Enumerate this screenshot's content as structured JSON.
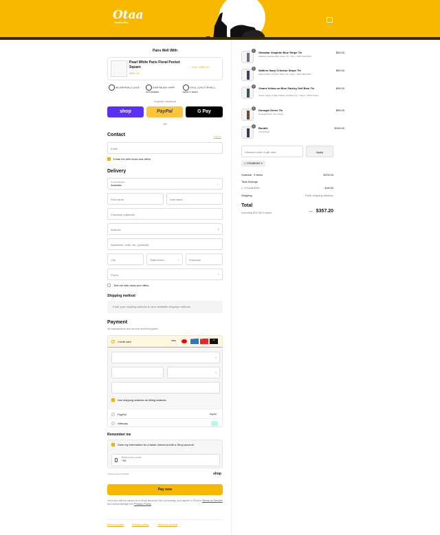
{
  "header": {
    "logo": "Otaa",
    "logo_tag": "Australia"
  },
  "pairs": {
    "title": "Pairs Well With",
    "product": "Pearl White Paris Floral Pocket Square",
    "action": "Add • A$30.00",
    "price": "A$30.00"
  },
  "badges": [
    "WE SHIP REALLY QUICK",
    "OVER 400,000+ HAPPY CUSTOMERS",
    "YOU'LL LOVE IT OR WE'LL MAKE IT RIGHT"
  ],
  "express": {
    "label": "Express checkout",
    "shop": "shop",
    "paypal": "PayPal",
    "gpay": "G Pay",
    "or": "OR"
  },
  "contact": {
    "title": "Contact",
    "login": "Log in",
    "email_placeholder": "Email",
    "news": "Email me with news and offers"
  },
  "delivery": {
    "title": "Delivery",
    "country_label": "Country/Region",
    "country": "Australia",
    "first": "First name",
    "last": "Last name",
    "company": "Company (optional)",
    "address": "Address",
    "apartment": "Apartment, suite, etc. (optional)",
    "city": "City",
    "state": "State/territo...",
    "postcode": "Postcode",
    "phone": "Phone",
    "text_news": "Text me with news and offers"
  },
  "shipping": {
    "title": "Shipping method",
    "note": "Enter your shipping address to view available shipping methods."
  },
  "payment": {
    "title": "Payment",
    "sub": "All transactions are secure and encrypted.",
    "card": "Credit card",
    "cards": [
      "VISA",
      "MC",
      "AMEX",
      "PAY",
      "+1"
    ],
    "billing": "Use shipping address as billing address",
    "paypal": "PayPal",
    "paypal_logo": "PayPal",
    "afterpay": "Afterpay"
  },
  "remember": {
    "title": "Remember me",
    "save": "Save my information for a faster checkout with a Shop account",
    "mobile_label": "Mobile phone number",
    "mobile": "+61",
    "secure": "Secure and encrypted",
    "shop": "shop"
  },
  "pay_now": "Pay now",
  "legal": {
    "text": "Your info will be saved to a Shop account. By continuing, you agree to Shop's",
    "tos": "Terms of Service",
    "and": "and acknowledge the",
    "privacy": "Privacy Policy"
  },
  "footer": [
    "Refund policy",
    "Privacy policy",
    "Terms of service"
  ],
  "items": [
    {
      "qty": "1",
      "name": "Gibraltar Graphite Blue Stripe Tie",
      "desc": "Gibraltar Graphite Blue Stripe Tie / Grey / 100% Microfiber",
      "price": "$59.00",
      "color": "#6b6f80"
    },
    {
      "qty": "1",
      "name": "Watters Navy Crimson Stripe Tie",
      "desc": "Watters Navy Crimson Stripe Tie / Navy / 100% Microfiber",
      "price": "$59.00",
      "color": "#443b66"
    },
    {
      "qty": "1",
      "name": "Vivara Yellow on Blue Paisley Self Bow Tie",
      "desc": "Vivara Yellow on Blue Paisley Self Bow Tie / Yellow / 100% Cotton",
      "price": "$49.00",
      "color": "#2e5a55"
    },
    {
      "qty": "1",
      "name": "Donegal Green Tie",
      "desc": "Donegal Green Tie / Green",
      "price": "$59.00",
      "color": "#6b4a30"
    },
    {
      "qty": "1",
      "name": "Bundle",
      "desc": "The Gift Set",
      "price": "$150.00",
      "color": "#3a3a55"
    }
  ],
  "discount": {
    "placeholder": "Discount code or gift card",
    "apply": "Apply",
    "code": "OTAABIND5"
  },
  "summary": {
    "subtotal_label": "Subtotal · 5 items",
    "subtotal": "$376.00",
    "savings_label": "Total Savings",
    "code": "OTAABIND5",
    "code_amount": "- $18.80",
    "shipping_label": "Shipping",
    "shipping": "Enter shipping address",
    "total_label": "Total",
    "currency": "AUD",
    "total": "$357.20",
    "tax": "Including $32.48 in taxes"
  }
}
